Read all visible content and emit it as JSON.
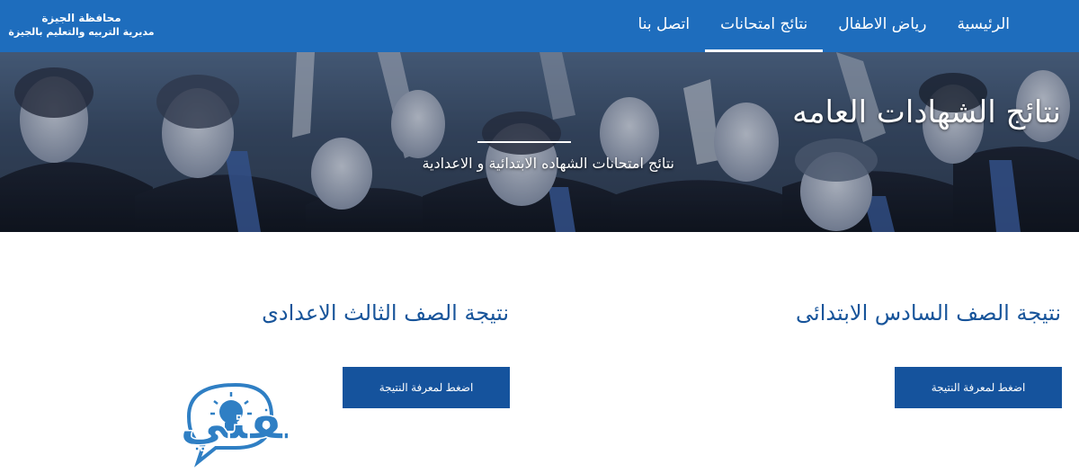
{
  "nav": {
    "links": [
      {
        "label": "الرئيسية"
      },
      {
        "label": "رياض الاطفال"
      },
      {
        "label": "نتائج امتحانات"
      },
      {
        "label": "اتصل بنا"
      }
    ],
    "active_index": 2
  },
  "brand": {
    "line1": "محافظة الجيزة",
    "line2": "مديرية التربيه والتعليم بالجيزة"
  },
  "hero": {
    "title": "نتائج الشهادات العامه",
    "subtitle": "نتائج امتحانات الشهاده الابتدائية و الاعدادية"
  },
  "cards": [
    {
      "title": "نتيجة الصف السادس الابتدائى",
      "button_label": "اضغط لمعرفة النتيجة"
    },
    {
      "title": "نتيجة الصف الثالث الاعدادى",
      "button_label": "اضغط لمعرفة النتيجة"
    }
  ],
  "logo": {
    "text": "ثقفني",
    "icon": "lightbulb-icon"
  },
  "colors": {
    "nav_bg": "#1e6dbd",
    "accent_blue": "#15539d",
    "title_blue": "#17549a",
    "logo_blue": "#2f7fc4"
  }
}
